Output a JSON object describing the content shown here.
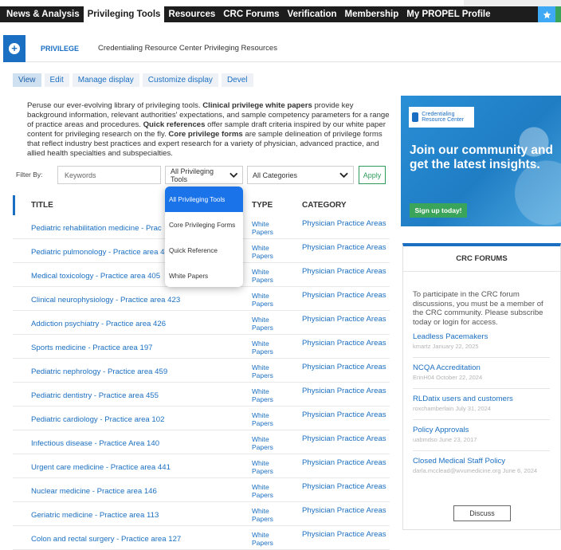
{
  "topnav": {
    "items": [
      "News & Analysis",
      "Privileging Tools",
      "Resources",
      "CRC Forums",
      "Verification",
      "Membership",
      "My PROPEL Profile"
    ]
  },
  "privbar": {
    "label": "PRIVILEGE",
    "title": "Credentialing Resource Center Privileging Resources"
  },
  "tabs": [
    "View",
    "Edit",
    "Manage display",
    "Customize display",
    "Devel"
  ],
  "intro": {
    "p1": "Peruse our ever-evolving library of privileging tools. ",
    "b1": "Clinical privilege white papers",
    "p2": " provide key background information, relevant authorities' expectations, and sample competency parameters for a range of practice areas and procedures. ",
    "b2": "Quick references",
    "p3": " offer sample draft criteria inspired by our white paper content for privileging research on the fly. ",
    "b3": "Core privilege forms",
    "p4": " are sample delineation of privilege forms that reflect industry best practices and expert research for a variety of physician, advanced practice, and allied health specialties and subspecialties."
  },
  "filters": {
    "label": "Filter By:",
    "keywords_placeholder": "Keywords",
    "tools_value": "All Privileging Tools",
    "category_value": "All Categories",
    "apply_label": "Apply"
  },
  "dropdown": {
    "options": [
      "All Privileging Tools",
      "Core Privileging Forms",
      "Quick Reference",
      "White Papers"
    ]
  },
  "table": {
    "headers": [
      "TITLE",
      "TYPE",
      "CATEGORY"
    ],
    "rows": [
      {
        "title": "Pediatric rehabilitation medicine - Prac",
        "type": "White Papers",
        "category": "Physician Practice Areas"
      },
      {
        "title": "Pediatric pulmonology - Practice area 4",
        "type": "White Papers",
        "category": "Physician Practice Areas"
      },
      {
        "title": "Medical toxicology - Practice area 405",
        "type": "White Papers",
        "category": "Physician Practice Areas"
      },
      {
        "title": "Clinical neurophysiology - Practice area 423",
        "type": "White Papers",
        "category": "Physician Practice Areas"
      },
      {
        "title": "Addiction psychiatry - Practice area 426",
        "type": "White Papers",
        "category": "Physician Practice Areas"
      },
      {
        "title": "Sports medicine - Practice area 197",
        "type": "White Papers",
        "category": "Physician Practice Areas"
      },
      {
        "title": "Pediatric nephrology - Practice area 459",
        "type": "White Papers",
        "category": "Physician Practice Areas"
      },
      {
        "title": "Pediatric dentistry - Practice area 455",
        "type": "White Papers",
        "category": "Physician Practice Areas"
      },
      {
        "title": "Pediatric cardiology - Practice area 102",
        "type": "White Papers",
        "category": "Physician Practice Areas"
      },
      {
        "title": "Infectious disease - Practice Area 140",
        "type": "White Papers",
        "category": "Physician Practice Areas"
      },
      {
        "title": "Urgent care medicine - Practice area 441",
        "type": "White Papers",
        "category": "Physician Practice Areas"
      },
      {
        "title": "Nuclear medicine - Practice area 146",
        "type": "White Papers",
        "category": "Physician Practice Areas"
      },
      {
        "title": "Geriatric medicine - Practice area 113",
        "type": "White Papers",
        "category": "Physician Practice Areas"
      },
      {
        "title": "Colon and rectal surgery - Practice area 127",
        "type": "White Papers",
        "category": "Physician Practice Areas"
      }
    ]
  },
  "ad": {
    "logo_text": "Credentialing Resource Center",
    "headline": "Join our community and get the latest insights.",
    "signup_label": "Sign up today!"
  },
  "forums": {
    "title": "CRC FORUMS",
    "description": "To participate in the CRC forum discussions, you must be a member of the CRC community. Please subscribe today or login for access.",
    "posts": [
      {
        "title": "Leadless Pacemakers",
        "meta": "kmartz  January 22, 2025"
      },
      {
        "title": "NCQA Accreditation",
        "meta": "ErinH04  October 22, 2024"
      },
      {
        "title": "RLDatix users and customers",
        "meta": "roxchamberlain  July 31, 2024"
      },
      {
        "title": "Policy Approvals",
        "meta": "uabmdso  June 23, 2017"
      },
      {
        "title": "Closed Medical Staff Policy",
        "meta": "darla.mcclead@wvumedicine.org June 6, 2024"
      }
    ],
    "discuss_label": "Discuss"
  },
  "colors": {
    "brand_blue": "#1b6fc2",
    "nav_dark": "#1d1d1d",
    "accent_green": "#3aa55a",
    "dropdown_selected": "#1a73e8"
  }
}
